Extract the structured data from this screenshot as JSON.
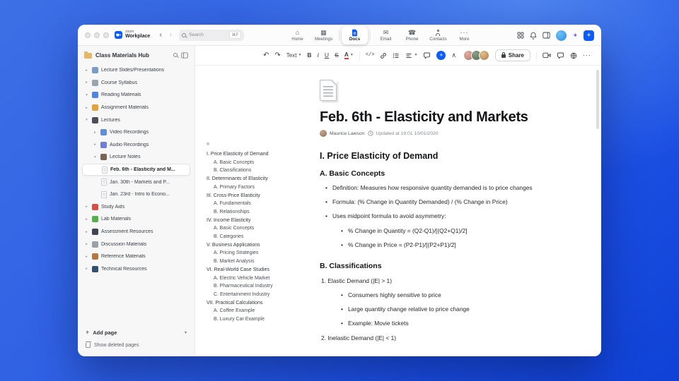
{
  "titlebar": {
    "brand_top": "zoom",
    "brand_bottom": "Workplace",
    "search_placeholder": "Search",
    "search_shortcut": "⌘F",
    "tabs": [
      {
        "label": "Home"
      },
      {
        "label": "Meetings"
      },
      {
        "label": "Docs"
      },
      {
        "label": "Email"
      },
      {
        "label": "Phone"
      },
      {
        "label": "Contacts"
      },
      {
        "label": "More"
      }
    ],
    "right_icons": [
      "apps",
      "notifications",
      "panel",
      "profile",
      "ai-companion",
      "new"
    ]
  },
  "sidebar": {
    "title": "Class Materials Hub",
    "items": [
      {
        "label": "Lecture Slides/Presentations",
        "icon": "presentation"
      },
      {
        "label": "Course Syllabus",
        "icon": "clipboard"
      },
      {
        "label": "Reading Materials",
        "icon": "open-book"
      },
      {
        "label": "Assignment Materials",
        "icon": "notebook-orange"
      },
      {
        "label": "Lectures",
        "icon": "graduation-cap"
      },
      {
        "label": "Video Recordings",
        "icon": "video-camera"
      },
      {
        "label": "Audio Recordings",
        "icon": "headphones"
      },
      {
        "label": "Lecture Notes",
        "icon": "notebook-brown"
      },
      {
        "label": "Feb. 6th - Elasticity and M...",
        "icon": "page"
      },
      {
        "label": "Jan. 30th - Markets and P...",
        "icon": "page"
      },
      {
        "label": "Jan. 23rd - Intro to Econo...",
        "icon": "page"
      },
      {
        "label": "Study Aids",
        "icon": "apple"
      },
      {
        "label": "Lab Materials",
        "icon": "pencil"
      },
      {
        "label": "Assessment Resources",
        "icon": "chart"
      },
      {
        "label": "Discussion Materials",
        "icon": "speech-bubble"
      },
      {
        "label": "Reference Materials",
        "icon": "books"
      },
      {
        "label": "Technical Resources",
        "icon": "device"
      }
    ],
    "add_page": "Add page",
    "show_deleted": "Show deleted pages"
  },
  "editor_toolbar": {
    "text_style": "Text",
    "bold": "B",
    "italic": "I",
    "underline": "U",
    "strikethrough": "S",
    "text_color": "A",
    "code": "</>",
    "share": "Share",
    "left_icons": [
      "undo",
      "redo",
      "text-style",
      "bold",
      "italic",
      "underline",
      "strikethrough",
      "text-color",
      "code",
      "link",
      "bullet-list",
      "align",
      "comment",
      "insert",
      "collapse-toolbar"
    ],
    "right_icons": [
      "video",
      "chat",
      "globe",
      "more"
    ]
  },
  "doc": {
    "title": "Feb. 6th - Elasticity and Markets",
    "author": "Maurice Lawson",
    "updated": "Updated at 19:01 10/01/2020",
    "toc": [
      {
        "label": "I. Price Elasticity of Demand"
      },
      {
        "label": "A. Basic Concepts"
      },
      {
        "label": "B. Classifications"
      },
      {
        "label": "II. Determinants of Elasticity"
      },
      {
        "label": "A. Primary Factors"
      },
      {
        "label": "III. Cross-Price Elasticity"
      },
      {
        "label": "A. Fundamentals"
      },
      {
        "label": "B. Relationships"
      },
      {
        "label": "IV. Income Elasticity"
      },
      {
        "label": "A. Basic Concepts"
      },
      {
        "label": "B. Categories"
      },
      {
        "label": "V. Business Applications"
      },
      {
        "label": "A. Pricing Strategies"
      },
      {
        "label": "B. Market Analysis"
      },
      {
        "label": "VI. Real-World Case Studies"
      },
      {
        "label": "A. Electric Vehicle Market"
      },
      {
        "label": "B. Pharmaceutical Industry"
      },
      {
        "label": "C. Entertainment Industry"
      },
      {
        "label": "VII. Practical Calculations"
      },
      {
        "label": "A. Coffee Example"
      },
      {
        "label": "B. Luxury Car Example"
      }
    ],
    "blocks": {
      "h1": "I. Price Elasticity of Demand",
      "h2a": "A. Basic Concepts",
      "b1": "Definition: Measures how responsive quantity demanded is to price changes",
      "b2": "Formula: (% Change in Quantity Demanded) / (% Change in Price)",
      "b3": "Uses midpoint formula to avoid asymmetry:",
      "s1": "% Change in Quantity = (Q2-Q1)/[(Q2+Q1)/2]",
      "s2": "% Change in Price = (P2-P1)/[(P2+P1)/2]",
      "h2b": "B. Classifications",
      "n1": "1. Elastic Demand (|E| > 1)",
      "nb1": "Consumers highly sensitive to price",
      "nb2": "Large quantity change relative to price change",
      "nb3": "Example: Movie tickets",
      "n2": "2. Inelastic Demand (|E| < 1)"
    }
  },
  "colors": {
    "accent": "#0b5cff"
  }
}
